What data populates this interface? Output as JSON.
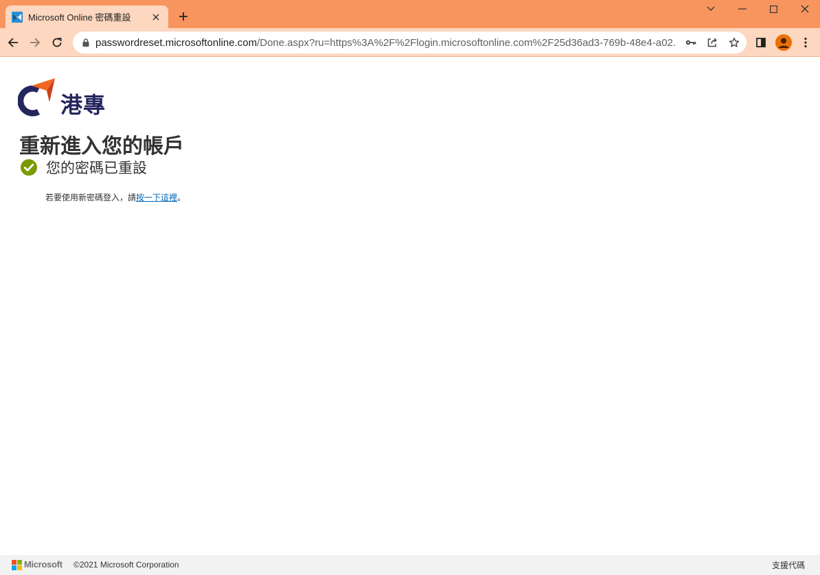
{
  "browser": {
    "tab_title": "Microsoft Online 密碼重設",
    "url_host": "passwordreset.microsoftonline.com",
    "url_path": "/Done.aspx?ru=https%3A%2F%2Flogin.microsoftonline.com%2F25d36ad3-769b-48e4-a02..."
  },
  "brand": {
    "name": "港專",
    "accent_color": "#f26522",
    "logo_color": "#26265e"
  },
  "page": {
    "heading": "重新進入您的帳戶",
    "success_message": "您的密碼已重設",
    "info_prefix": "若要使用新密碼登入，請",
    "info_link": "按一下這裡",
    "info_suffix": "。"
  },
  "footer": {
    "ms_logo_text": "Microsoft",
    "copyright": "©2021 Microsoft Corporation",
    "support_code": "支援代碼"
  },
  "colors": {
    "titlebar": "#f8955f",
    "toolbar": "#fdd7bf",
    "success": "#7a9a01",
    "link": "#0067b8"
  }
}
